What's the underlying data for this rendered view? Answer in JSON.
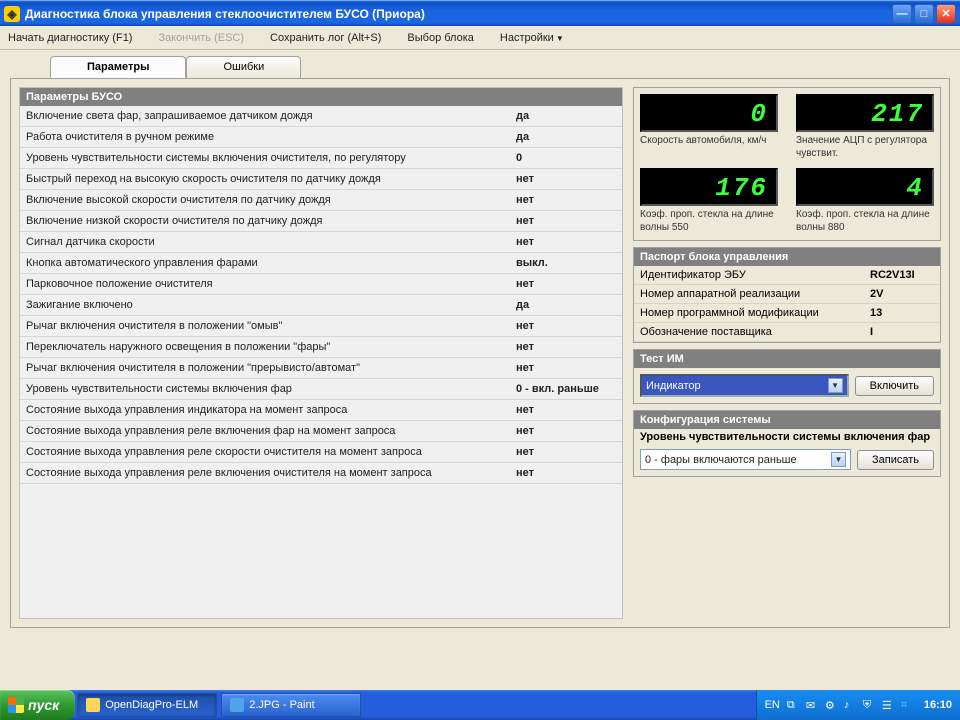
{
  "window": {
    "title": "Диагностика блока управления стеклоочистителем БУСО (Приора)"
  },
  "menu": {
    "start": "Начать диагностику (F1)",
    "stop": "Закончить (ESC)",
    "savelog": "Сохранить лог (Alt+S)",
    "select_block": "Выбор блока",
    "settings": "Настройки"
  },
  "tabs": {
    "params": "Параметры",
    "errors": "Ошибки"
  },
  "params_header": "Параметры БУСО",
  "params": [
    {
      "name": "Включение света фар, запрашиваемое датчиком дождя",
      "val": "да"
    },
    {
      "name": "Работа очистителя в ручном режиме",
      "val": "да"
    },
    {
      "name": "Уровень чувствительности системы включения очистителя, по регулятору",
      "val": "0"
    },
    {
      "name": "Быстрый переход на высокую скорость очистителя по датчику дождя",
      "val": "нет"
    },
    {
      "name": "Включение высокой скорости очистителя по датчику дождя",
      "val": "нет"
    },
    {
      "name": "Включение низкой скорости очистителя по датчику дождя",
      "val": "нет"
    },
    {
      "name": "Сигнал датчика скорости",
      "val": "нет"
    },
    {
      "name": "Кнопка автоматического управления фарами",
      "val": "выкл."
    },
    {
      "name": "Парковочное положение очистителя",
      "val": "нет"
    },
    {
      "name": "Зажигание включено",
      "val": "да"
    },
    {
      "name": "Рычаг включения очистителя в положении \"омыв\"",
      "val": "нет"
    },
    {
      "name": "Переключатель наружного освещения в положении \"фары\"",
      "val": "нет"
    },
    {
      "name": "Рычаг включения очистителя в положении \"прерывисто/автомат\"",
      "val": "нет"
    },
    {
      "name": "Уровень чувствительности системы включения фар",
      "val": "0 - вкл. раньше"
    },
    {
      "name": "Состояние выхода управления индикатора на момент запроса",
      "val": "нет"
    },
    {
      "name": "Состояние выхода управления реле включения фар на момент запроса",
      "val": "нет"
    },
    {
      "name": "Состояние выхода управления реле скорости очистителя на момент запроса",
      "val": "нет"
    },
    {
      "name": "Состояние выхода управления реле включения очистителя на момент запроса",
      "val": "нет"
    }
  ],
  "gauges": {
    "g1_val": "0",
    "g1_label": "Скорость автомобиля, км/ч",
    "g2_val": "217",
    "g2_label": "Значение АЦП с регулятора чувствит.",
    "g3_val": "176",
    "g3_label": "Коэф. проп. стекла на длине волны 550",
    "g4_val": "4",
    "g4_label": "Коэф. проп. стекла на длине волны 880"
  },
  "passport": {
    "header": "Паспорт блока управления",
    "rows": [
      {
        "label": "Идентификатор ЭБУ",
        "val": "RC2V13I"
      },
      {
        "label": "Номер аппаратной реализации",
        "val": "2V"
      },
      {
        "label": "Номер программной модификации",
        "val": "13"
      },
      {
        "label": "Обозначение поставщика",
        "val": "I"
      }
    ]
  },
  "test_im": {
    "header": "Тест ИМ",
    "combo": "Индикатор",
    "button": "Включить"
  },
  "config": {
    "header": "Конфигурация системы",
    "label": "Уровень чувствительности системы включения фар",
    "combo": "0 - фары включаются раньше",
    "button": "Записать"
  },
  "taskbar": {
    "start": "пуск",
    "task1": "OpenDiagPro-ELM",
    "task2": "2.JPG - Paint",
    "lang": "EN",
    "clock": "16:10"
  }
}
